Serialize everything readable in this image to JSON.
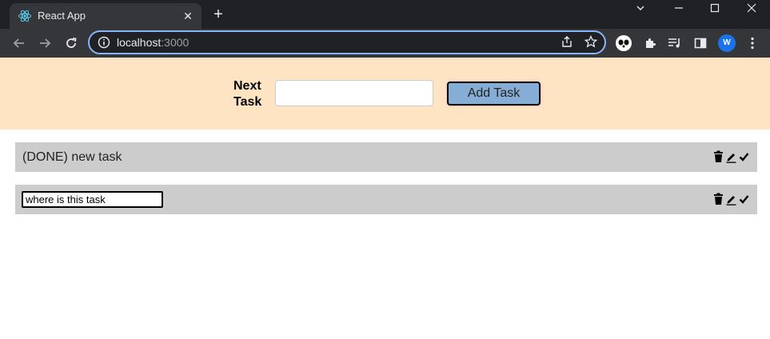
{
  "browser": {
    "tab_title": "React App",
    "tab_close": "✕",
    "new_tab": "+",
    "url_host": "localhost",
    "url_port": ":3000",
    "profile_initial": "W"
  },
  "app": {
    "next_task_label": "Next Task",
    "task_input_value": "",
    "add_button_label": "Add Task",
    "tasks": [
      {
        "text": "(DONE) new task",
        "editing": false
      },
      {
        "text": "where is this task",
        "editing": true
      }
    ]
  },
  "icons": {
    "favicon": "react-logo-icon",
    "actions": [
      "trash-icon",
      "pencil-icon",
      "checkmark-icon"
    ]
  },
  "colors": {
    "header_band": "#ffe4c4",
    "add_button": "#86add6",
    "task_row": "#cccccc",
    "omnibox_focus": "#8ab4f8"
  }
}
